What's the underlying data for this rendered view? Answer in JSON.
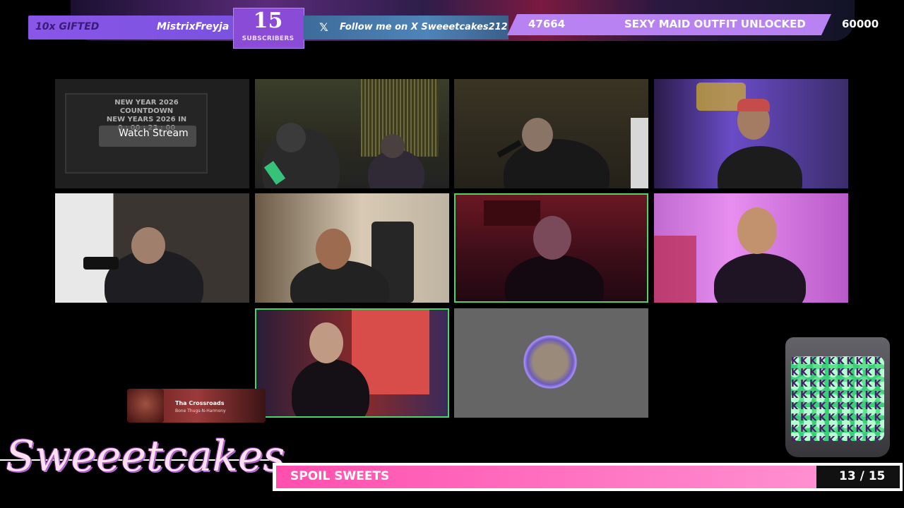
{
  "top_bar": {
    "gift_count": "10x GIFTED",
    "gifter_name": "MistrixFreyja",
    "subscribers_count": "15",
    "subscribers_label": "SUBSCRIBERS",
    "follow_text": "Follow me on X Sweeetcakes212",
    "goal_current": "47664",
    "goal_title": "SEXY MAID OUTFIT UNLOCKED",
    "goal_target": "60000",
    "goal_progress_fraction": 0.79
  },
  "tiles": {
    "watch_stream_label": "Watch Stream",
    "countdown_lines": "NEW YEAR 2026\nCOUNTDOWN\nNEW YEARS 2026 IN\n0 : 00 : 23 : 00"
  },
  "music": {
    "title": "Tha Crossroads",
    "artist": "Bone Thugs-N-Harmony"
  },
  "jar": {
    "icon": "coin-jar-icon",
    "glyphs": "KKKKKKKKKKKKKKKKKKKKKKKKKKKKKKKKKKKKKKKKKKKKKKKKKKKKKKKKKKKKKKKKKKKKKKKKKKKKKKKK"
  },
  "brand": {
    "name": "Sweeetcakes"
  },
  "spoil_bar": {
    "label": "SPOIL SWEETS",
    "count": "13 / 15",
    "progress_fraction": 0.866,
    "fill_color": "#ff5fb8"
  },
  "colors": {
    "accent_purple": "#8a56e8",
    "highlight_green": "#4cd46a"
  }
}
